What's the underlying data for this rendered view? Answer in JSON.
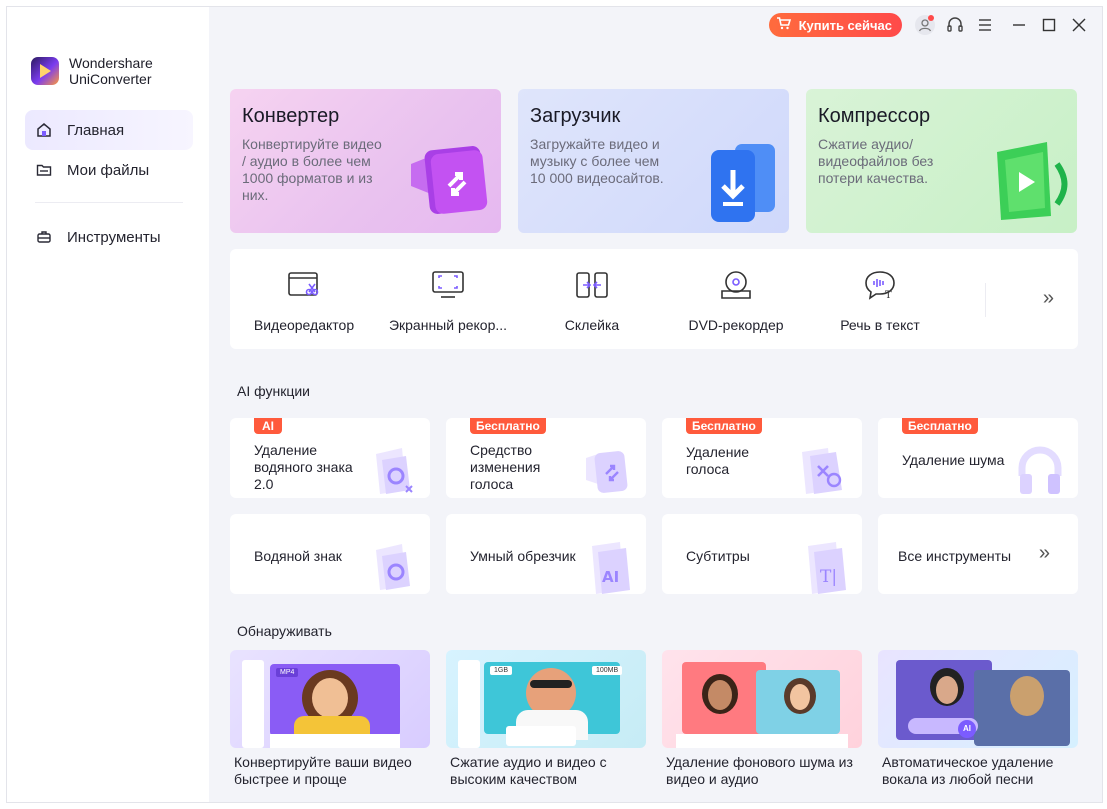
{
  "app": {
    "brand_line1": "Wondershare",
    "brand_line2": "UniConverter"
  },
  "sidebar": {
    "items": [
      {
        "label": "Главная",
        "icon": "home-icon",
        "active": true
      },
      {
        "label": "Мои файлы",
        "icon": "folder-icon",
        "active": false
      },
      {
        "label": "Инструменты",
        "icon": "toolbox-icon",
        "active": false
      }
    ]
  },
  "titlebar": {
    "buy_label": "Купить сейчас"
  },
  "hero": [
    {
      "title": "Конвертер",
      "desc": "Конвертируйте видео / аудио в более чем 1000 форматов и из них."
    },
    {
      "title": "Загрузчик",
      "desc": "Загружайте видео и музыку с более чем 10 000 видеосайтов."
    },
    {
      "title": "Компрессор",
      "desc": "Сжатие аудио/ видеофайлов без потери качества."
    }
  ],
  "tools": [
    {
      "label": "Видеоредактор",
      "icon": "video-editor-icon"
    },
    {
      "label": "Экранный рекор...",
      "icon": "screen-recorder-icon"
    },
    {
      "label": "Склейка",
      "icon": "merge-icon"
    },
    {
      "label": "DVD-рекордер",
      "icon": "dvd-icon"
    },
    {
      "label": "Речь в текст",
      "icon": "speech-to-text-icon"
    }
  ],
  "ai_section": {
    "title": "AI функции",
    "cards": [
      {
        "label": "Удаление водяного знака 2.0",
        "badge": "AI"
      },
      {
        "label": "Средство изменения голоса",
        "badge": "Бесплатно"
      },
      {
        "label": "Удаление голоса",
        "badge": "Бесплатно"
      },
      {
        "label": "Удаление шума",
        "badge": "Бесплатно"
      },
      {
        "label": "Водяной знак",
        "badge": ""
      },
      {
        "label": "Умный обрезчик",
        "badge": ""
      },
      {
        "label": "Субтитры",
        "badge": ""
      },
      {
        "label": "Все инструменты",
        "badge": ""
      }
    ]
  },
  "discover": {
    "title": "Обнаруживать",
    "items": [
      {
        "text": "Конвертируйте ваши видео быстрее и проще",
        "thumb_tag": "MP4"
      },
      {
        "text": "Сжатие аудио и видео с высоким качеством",
        "thumb_tag": "1GB",
        "thumb_tag2": "100MB"
      },
      {
        "text": "Удаление фонового шума из видео и аудио"
      },
      {
        "text": "Автоматическое удаление вокала из любой песни",
        "thumb_tag": "AI"
      }
    ]
  },
  "colors": {
    "accent": "#7b5cff",
    "buy_start": "#ff6b3d",
    "buy_end": "#ff4a4a",
    "badge": "#ff5a3c"
  }
}
